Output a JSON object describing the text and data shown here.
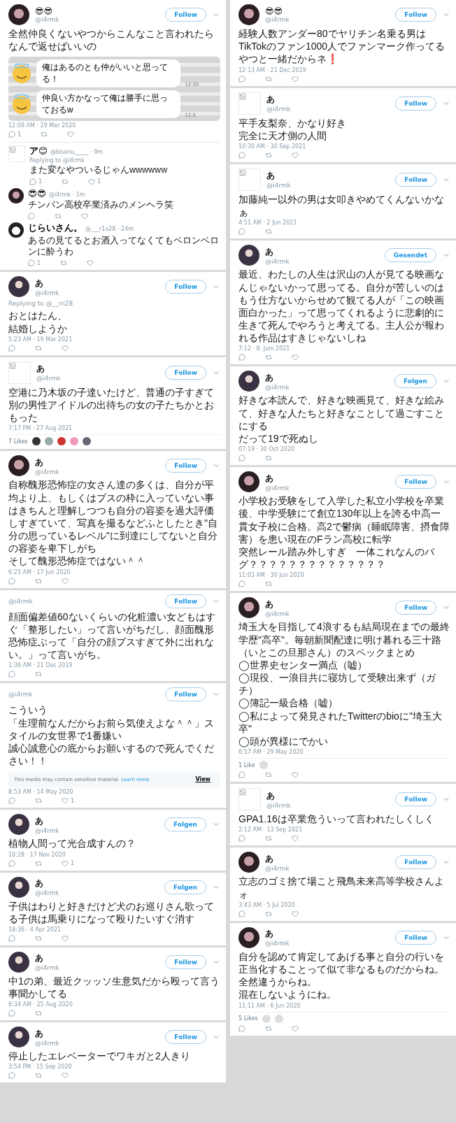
{
  "columns": [
    {
      "tweets": [
        {
          "avatar": {
            "kind": "dark"
          },
          "name": "😎😎",
          "handle": "@i4rmk",
          "follow": "Follow",
          "lines": [
            "全然仲良くないやつからこんなこと言われたらなんで返せばいいの"
          ],
          "media": {
            "kind": "chat",
            "bubbles": [
              {
                "text": "俺はあるのとも仲がいいと思ってる！",
                "time": "12:30"
              },
              {
                "text": "仲良い方かなって俺は勝手に思っておるw",
                "time": "12:3"
              }
            ]
          },
          "time": "12:09 AM · 29 Mar 2020",
          "actions": [
            {
              "kind": "reply",
              "count": "1"
            },
            {
              "kind": "retweet"
            },
            {
              "kind": "like"
            }
          ],
          "replies": [
            {
              "avatar": {
                "kind": "broken"
              },
              "name": "ア😊",
              "meta": "@bisonu_____ · 9m",
              "replying_to": "Replying to @i4rmk",
              "text": "また変なやついるじゃんwwwwww",
              "actions": [
                {
                  "kind": "reply",
                  "count": "1"
                },
                {
                  "kind": "retweet"
                },
                {
                  "kind": "like",
                  "count": "1"
                }
              ]
            },
            {
              "avatar": {
                "kind": "dark"
              },
              "name": "😎😎",
              "meta": "@i4rmk · 1m",
              "text": "チンパン高校卒業済みのメンヘラ笑",
              "actions": [
                {
                  "kind": "reply"
                },
                {
                  "kind": "retweet"
                },
                {
                  "kind": "like"
                }
              ]
            },
            {
              "avatar": {
                "kind": "sketch"
              },
              "name": "じらいさん。",
              "meta": "@___r1o28 · 24m",
              "text": "あるの見てるとお酒入ってなくてもベロンベロンに酔うわ",
              "actions": [
                {
                  "kind": "reply",
                  "count": "1"
                },
                {
                  "kind": "retweet"
                },
                {
                  "kind": "like"
                }
              ]
            }
          ]
        },
        {
          "avatar": {
            "kind": "girl"
          },
          "name": "あ",
          "handle": "@i4rmk",
          "follow": "Follow",
          "replying_to": "Replying to @__rn28",
          "lines": [
            "おとはたん、",
            "結婚しようか"
          ],
          "time": "5:23 AM · 19 Mar 2021",
          "actions": [
            {
              "kind": "reply"
            },
            {
              "kind": "retweet"
            },
            {
              "kind": "like"
            }
          ]
        },
        {
          "avatar": {
            "kind": "broken"
          },
          "name": "あ",
          "handle": "@i4rmk",
          "follow": "Follow",
          "lines": [
            "空港に乃木坂の子達いたけど、普通の子すぎて別の男性アイドルの出待ちの女の子たちかとおもった"
          ],
          "time": "7:17 PM · 27 Aug 2021",
          "likes": "7 Likes",
          "likers": [
            {
              "kind": "dark"
            },
            {
              "kind": "text"
            },
            {
              "kind": "red"
            },
            {
              "kind": "pink"
            },
            {
              "kind": "flower"
            }
          ]
        },
        {
          "avatar": {
            "kind": "dark"
          },
          "name": "あ",
          "handle": "@i4rmk",
          "follow": "Follow",
          "lines": [
            "自称醜形恐怖症の女さん達の多くは、自分が平均より上、もしくはブスの枠に入っていない事はきちんと理解しつつも自分の容姿を過大評価しすぎていて、写真を撮るなどふとしたとき\"自分の思っているレベル\"に到達にしてないと自分の容姿を卑下しがち",
            "そして醜形恐怖症ではない＾＾"
          ],
          "time": "6:25 AM · 17 Jun 2020",
          "actions": [
            {
              "kind": "reply"
            },
            {
              "kind": "retweet"
            },
            {
              "kind": "like"
            }
          ]
        },
        {
          "avatar": {
            "kind": "none"
          },
          "handle": "@i4rmk",
          "follow": "Follow",
          "lines": [
            "顔面偏差値60ないくらいの化粧濃い女どもはすぐ「整形したい」って言いがちだし、顔面醜形恐怖症ぶって「自分の顔ブスすぎて外に出れない。」って言いがち。"
          ],
          "time": "1:36 AM · 21 Dec 2019",
          "actions": [
            {
              "kind": "reply"
            },
            {
              "kind": "retweet"
            }
          ]
        },
        {
          "avatar": {
            "kind": "none"
          },
          "handle": "@i4rmk",
          "follow": "Follow",
          "lines": [
            "こういう",
            "「生理前なんだからお前ら気使えよな＾＾」スタイルの女世界で1番嫌い",
            "誠心誠意心の底からお願いするので死んでください！！"
          ],
          "media": {
            "kind": "sensitive",
            "notice": "This media may contain sensitive material.",
            "link": "Learn more",
            "view": "View"
          },
          "time": "8:53 AM · 14 May 2020",
          "actions": [
            {
              "kind": "reply"
            },
            {
              "kind": "retweet"
            },
            {
              "kind": "like",
              "count": "1"
            }
          ]
        },
        {
          "avatar": {
            "kind": "girl"
          },
          "name": "あ",
          "handle": "@i4rmk",
          "follow": "Folgen",
          "lines": [
            "植物人間って光合成すんの？"
          ],
          "time": "10:28 · 17 Nov 2020",
          "actions": [
            {
              "kind": "reply"
            },
            {
              "kind": "retweet"
            },
            {
              "kind": "like",
              "count": "1"
            }
          ]
        },
        {
          "avatar": {
            "kind": "girl"
          },
          "name": "あ",
          "handle": "@i4rmk",
          "follow": "Folgen",
          "lines": [
            "子供はわりと好きだけど犬のお巡りさん歌ってる子供は馬乗りになって殴りたいすぐ消す"
          ],
          "time": "18:36 · 4 Apr 2021",
          "actions": [
            {
              "kind": "reply"
            },
            {
              "kind": "retweet"
            },
            {
              "kind": "like"
            }
          ]
        },
        {
          "avatar": {
            "kind": "girl"
          },
          "name": "あ",
          "handle": "@i4rmk",
          "follow": "Follow",
          "lines": [
            "中1の弟、最近クッッソ生意気だから殴って言う事聞かしてる"
          ],
          "time": "6:34 AM · 25 Aug 2020",
          "actions": [
            {
              "kind": "reply"
            },
            {
              "kind": "retweet"
            }
          ]
        },
        {
          "avatar": {
            "kind": "girl"
          },
          "name": "あ",
          "handle": "@i4rmk",
          "follow": "Follow",
          "lines": [
            "停止したエレベーターでワキガと2人きり"
          ],
          "time": "3:54 PM · 15 Sep 2020",
          "actions": [
            {
              "kind": "reply"
            },
            {
              "kind": "retweet"
            },
            {
              "kind": "like"
            }
          ]
        }
      ]
    },
    {
      "tweets": [
        {
          "avatar": {
            "kind": "dark"
          },
          "name": "😎😎",
          "handle": "@i4rmk",
          "follow": "Follow",
          "lines": [
            "経験人数アンダー80でヤリチン名乗る男はTikTokのファン1000人でファンマーク作ってるやつと一緒だからネ❗"
          ],
          "time": "12:13 AM · 21 Dec 2019",
          "actions": [
            {
              "kind": "reply"
            },
            {
              "kind": "retweet"
            },
            {
              "kind": "like"
            }
          ]
        },
        {
          "avatar": {
            "kind": "broken"
          },
          "name": "あ",
          "handle": "@i4rmk",
          "follow": "Follow",
          "lines": [
            "平手友梨奈、かなり好き",
            "完全に天才側の人間"
          ],
          "time": "10:30 AM · 30 Sep 2021",
          "actions": [
            {
              "kind": "reply"
            },
            {
              "kind": "retweet"
            },
            {
              "kind": "like"
            }
          ]
        },
        {
          "avatar": {
            "kind": "broken"
          },
          "name": "あ",
          "handle": "@i4rmk",
          "follow": "Follow",
          "lines": [
            "加藤純一以外の男は女叩きやめてくんないかなぁ"
          ],
          "time": "4:51 AM · 2 Jun 2021",
          "actions": [
            {
              "kind": "reply"
            },
            {
              "kind": "retweet"
            }
          ]
        },
        {
          "avatar": {
            "kind": "girl"
          },
          "name": "あ",
          "handle": "@i4rmk",
          "follow": "Gesendet",
          "lines": [
            "最近、わたしの人生は沢山の人が見てる映画なんじゃないかって思ってる。自分が苦しいのはもう仕方ないからせめて観てる人が「この映画面白かった」って思ってくれるように悲劇的に生きて死んでやろうと考えてる。主人公が報われる作品はすきじゃないしね"
          ],
          "time": "7:12 · 8. Juni 2021",
          "actions": [
            {
              "kind": "reply"
            },
            {
              "kind": "retweet"
            },
            {
              "kind": "like"
            }
          ]
        },
        {
          "avatar": {
            "kind": "girl"
          },
          "name": "あ",
          "handle": "@i4rmk",
          "follow": "Folgen",
          "lines": [
            "好きな本読んで、好きな映画見て、好きな絵みて、好きな人たちと好きなことして過ごすことにする",
            "だって19で死ぬし"
          ],
          "time": "07:19 · 30 Oct 2020",
          "actions": [
            {
              "kind": "reply"
            },
            {
              "kind": "retweet"
            }
          ]
        },
        {
          "avatar": {
            "kind": "dark"
          },
          "name": "あ",
          "handle": "@i4rmk",
          "follow": "Follow",
          "lines": [
            "小学校お受験をして入学した私立小学校を卒業後、中学受験にて創立130年以上を誇る中高一貫女子校に合格。高2で鬱病（睡眠障害、摂食障害）を患い現在のFラン高校に転学",
            "突然レール踏み外しすぎ　一体これなんのバグ？？？？？？？？？？？？？？"
          ],
          "time": "11:03 AM · 30 Jun 2020",
          "actions": [
            {
              "kind": "reply"
            },
            {
              "kind": "retweet"
            }
          ]
        },
        {
          "avatar": {
            "kind": "dark"
          },
          "name": "あ",
          "handle": "@i4rmk",
          "follow": "Follow",
          "lines": [
            "埼玉大を目指して4浪するも結局現在までの最終学歴\"高卒\"。毎朝新聞配達に明け暮れる三十路（いとこの旦那さん）のスペックまとめ",
            "◯世界史センター満点（嘘）",
            "◯現役、一浪目共に寝坊して受験出来ず（ガチ）",
            "◯簿記一級合格（嘘）",
            "◯私によって発見されたTwitterのbioに\"埼玉大卒\"",
            "◯頭が異様にでかい"
          ],
          "time": "6:57 AM · 29 May 2020",
          "likes": "1 Like",
          "likers": [
            {
              "kind": "broken"
            }
          ],
          "actions": [
            {
              "kind": "reply"
            },
            {
              "kind": "retweet"
            },
            {
              "kind": "like"
            }
          ]
        },
        {
          "avatar": {
            "kind": "broken"
          },
          "name": "あ",
          "handle": "@i4rmk",
          "follow": "Follow",
          "lines": [
            "GPA1.16は卒業危ういって言われたしくしく"
          ],
          "time": "2:12 AM · 13 Sep 2021",
          "actions": [
            {
              "kind": "reply"
            },
            {
              "kind": "retweet"
            },
            {
              "kind": "like"
            }
          ]
        },
        {
          "avatar": {
            "kind": "dark"
          },
          "name": "あ",
          "handle": "@i4rmk",
          "follow": "Follow",
          "lines": [
            "立志のゴミ捨て場こと飛鳥未来高等学校さんよォ"
          ],
          "time": "3:43 AM · 5 Jul 2020",
          "actions": [
            {
              "kind": "reply"
            },
            {
              "kind": "retweet"
            },
            {
              "kind": "like"
            }
          ]
        },
        {
          "avatar": {
            "kind": "dark"
          },
          "name": "あ",
          "handle": "@i4rmk",
          "follow": "Follow",
          "lines": [
            "自分を認めて肯定してあげる事と自分の行いを正当化することって似て非なるものだからね。",
            "全然違うからね。",
            "混在しないようにね。"
          ],
          "time": "11:11 AM · 6 Jun 2020",
          "likes": "5 Likes",
          "likers": [
            {
              "kind": "broken"
            },
            {
              "kind": "broken"
            }
          ],
          "actions": [
            {
              "kind": "reply"
            },
            {
              "kind": "retweet"
            },
            {
              "kind": "like"
            }
          ]
        }
      ]
    }
  ]
}
